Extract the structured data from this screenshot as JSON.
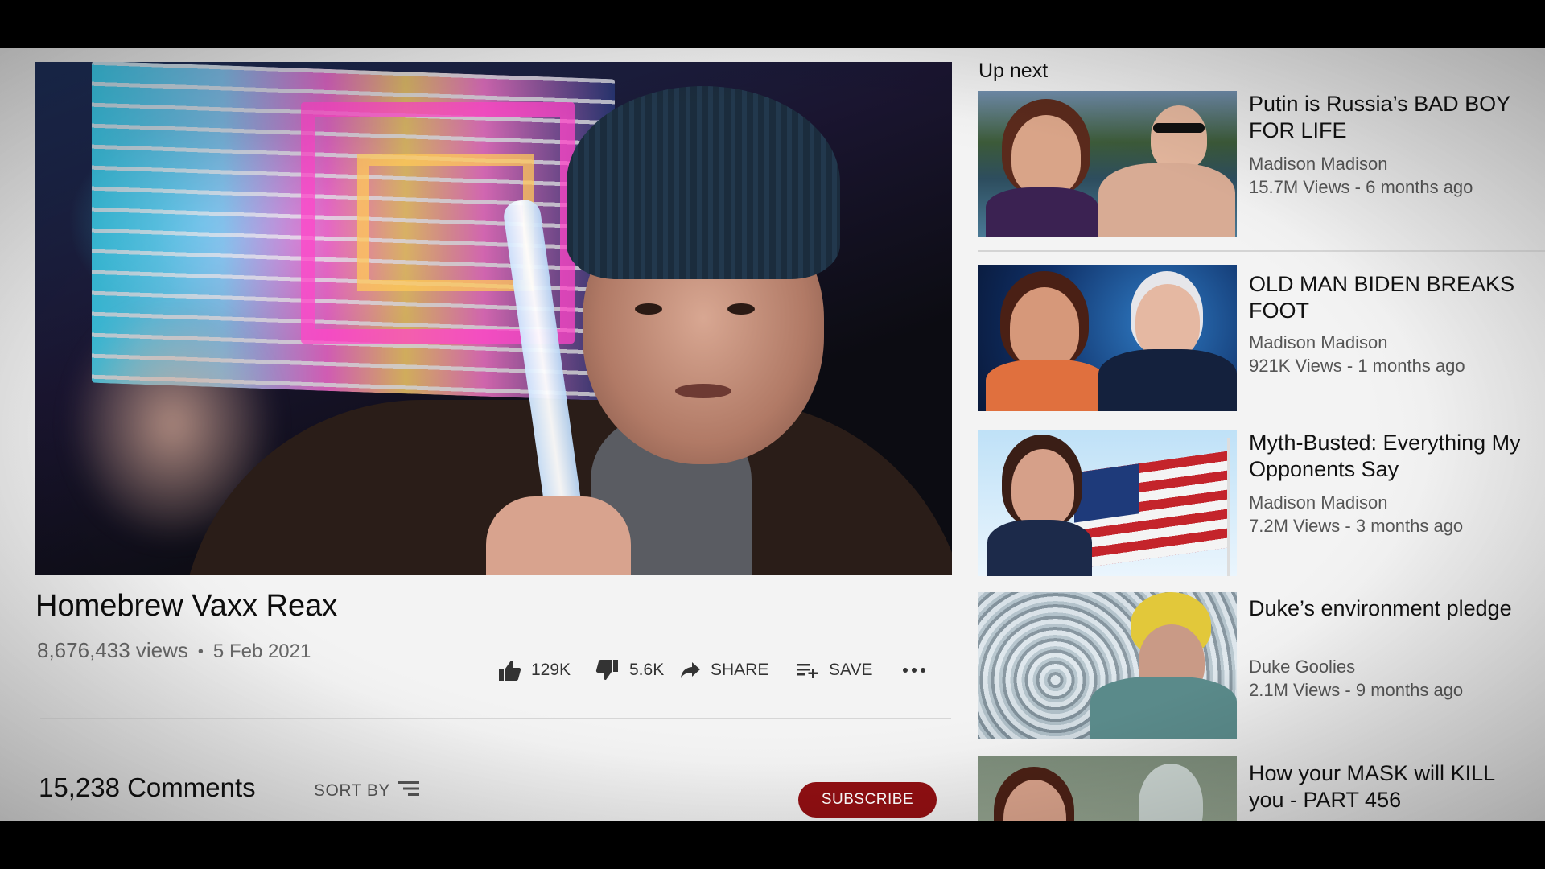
{
  "video": {
    "title": "Homebrew Vaxx Reax",
    "views": "8,676,433 views",
    "separator": "•",
    "date": "5 Feb 2021"
  },
  "actions": {
    "like_count": "129K",
    "dislike_count": "5.6K",
    "share_label": "SHARE",
    "save_label": "SAVE",
    "more_label": "..."
  },
  "comments": {
    "count_label": "15,238 Comments",
    "sort_label": "SORT BY",
    "subscribe_label": "SUBSCRIBE"
  },
  "sidebar": {
    "up_next_label": "Up next",
    "items": [
      {
        "title": "Putin is Russia’s BAD BOY FOR LIFE",
        "channel": "Madison Madison",
        "stats": "15.7M Views - 6 months ago"
      },
      {
        "title": "OLD MAN BIDEN BREAKS FOOT",
        "channel": "Madison Madison",
        "stats": "921K Views - 1 months ago"
      },
      {
        "title": "Myth-Busted: Everything My Opponents Say",
        "channel": "Madison Madison",
        "stats": "7.2M Views - 3 months ago"
      },
      {
        "title": "Duke’s environment pledge",
        "channel": "Duke Goolies",
        "stats": "2.1M Views - 9 months ago"
      },
      {
        "title": "How your MASK will KILL you - PART 456",
        "channel": "",
        "stats": ""
      }
    ]
  },
  "colors": {
    "subscribe_bg": "#8f0f12",
    "page_bg": "#f3f3f3",
    "meta_text": "#666666"
  },
  "icons": {
    "like": "thumbs-up-icon",
    "dislike": "thumbs-down-icon",
    "share": "share-arrow-icon",
    "save": "playlist-add-icon",
    "more": "more-dots-icon",
    "sort": "sort-lines-icon"
  }
}
